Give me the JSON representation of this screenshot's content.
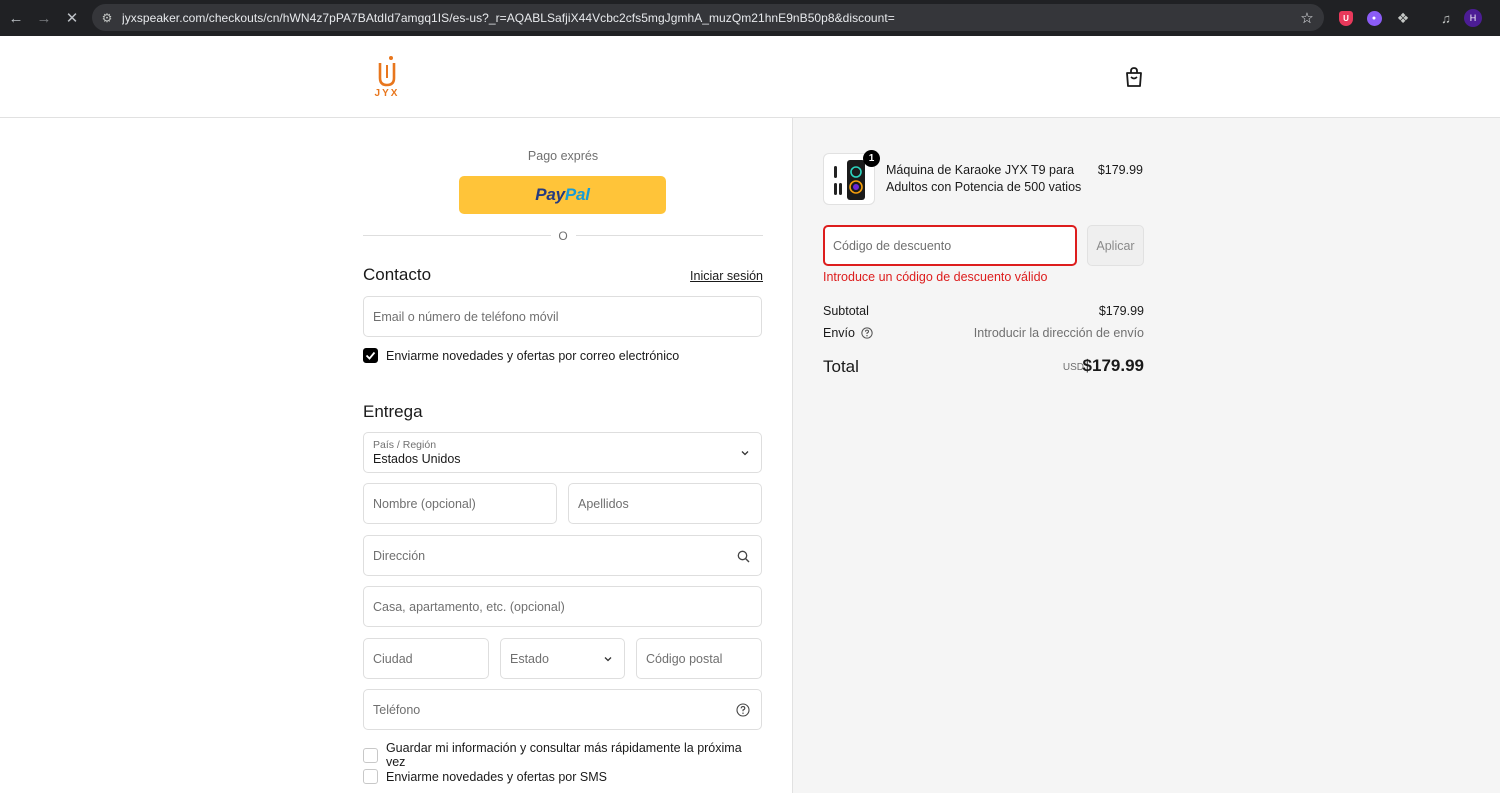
{
  "browser": {
    "url": "jyxspeaker.com/checkouts/cn/hWN4z7pPA7BAtdId7amgq1IS/es-us?_r=AQABLSafjiX44Vcbc2cfs5mgJgmhA_muzQm21hnE9nB50p8&discount=",
    "profile_initial": "H"
  },
  "header": {
    "logo_text": "JYX"
  },
  "express": {
    "label": "Pago exprés",
    "paypal_pay": "Pay",
    "paypal_pal": "Pal",
    "divider": "O"
  },
  "contact": {
    "title": "Contacto",
    "login_link": "Iniciar sesión",
    "email_placeholder": "Email o número de teléfono móvil",
    "newsletter_label": "Enviarme novedades y ofertas por correo electrónico"
  },
  "delivery": {
    "title": "Entrega",
    "country_label": "País / Región",
    "country_value": "Estados Unidos",
    "first_name_placeholder": "Nombre (opcional)",
    "last_name_placeholder": "Apellidos",
    "address_placeholder": "Dirección",
    "apartment_placeholder": "Casa, apartamento, etc. (opcional)",
    "city_placeholder": "Ciudad",
    "state_placeholder": "Estado",
    "zip_placeholder": "Código postal",
    "phone_placeholder": "Teléfono",
    "save_info_label": "Guardar mi información y consultar más rápidamente la próxima vez",
    "sms_label": "Enviarme novedades y ofertas por SMS"
  },
  "summary": {
    "product_name": "Máquina de Karaoke JYX T9 para Adultos con Potencia de 500 vatios",
    "product_price": "$179.99",
    "quantity": "1",
    "discount_placeholder": "Código de descuento",
    "apply_label": "Aplicar",
    "discount_error": "Introduce un código de descuento válido",
    "subtotal_label": "Subtotal",
    "subtotal_value": "$179.99",
    "shipping_label": "Envío",
    "shipping_value": "Introducir la dirección de envío",
    "total_label": "Total",
    "total_currency": "USD",
    "total_value": "$179.99"
  },
  "colors": {
    "accent_orange": "#e8761d",
    "paypal_yellow": "#ffc439",
    "error_red": "#dd1d1d"
  }
}
